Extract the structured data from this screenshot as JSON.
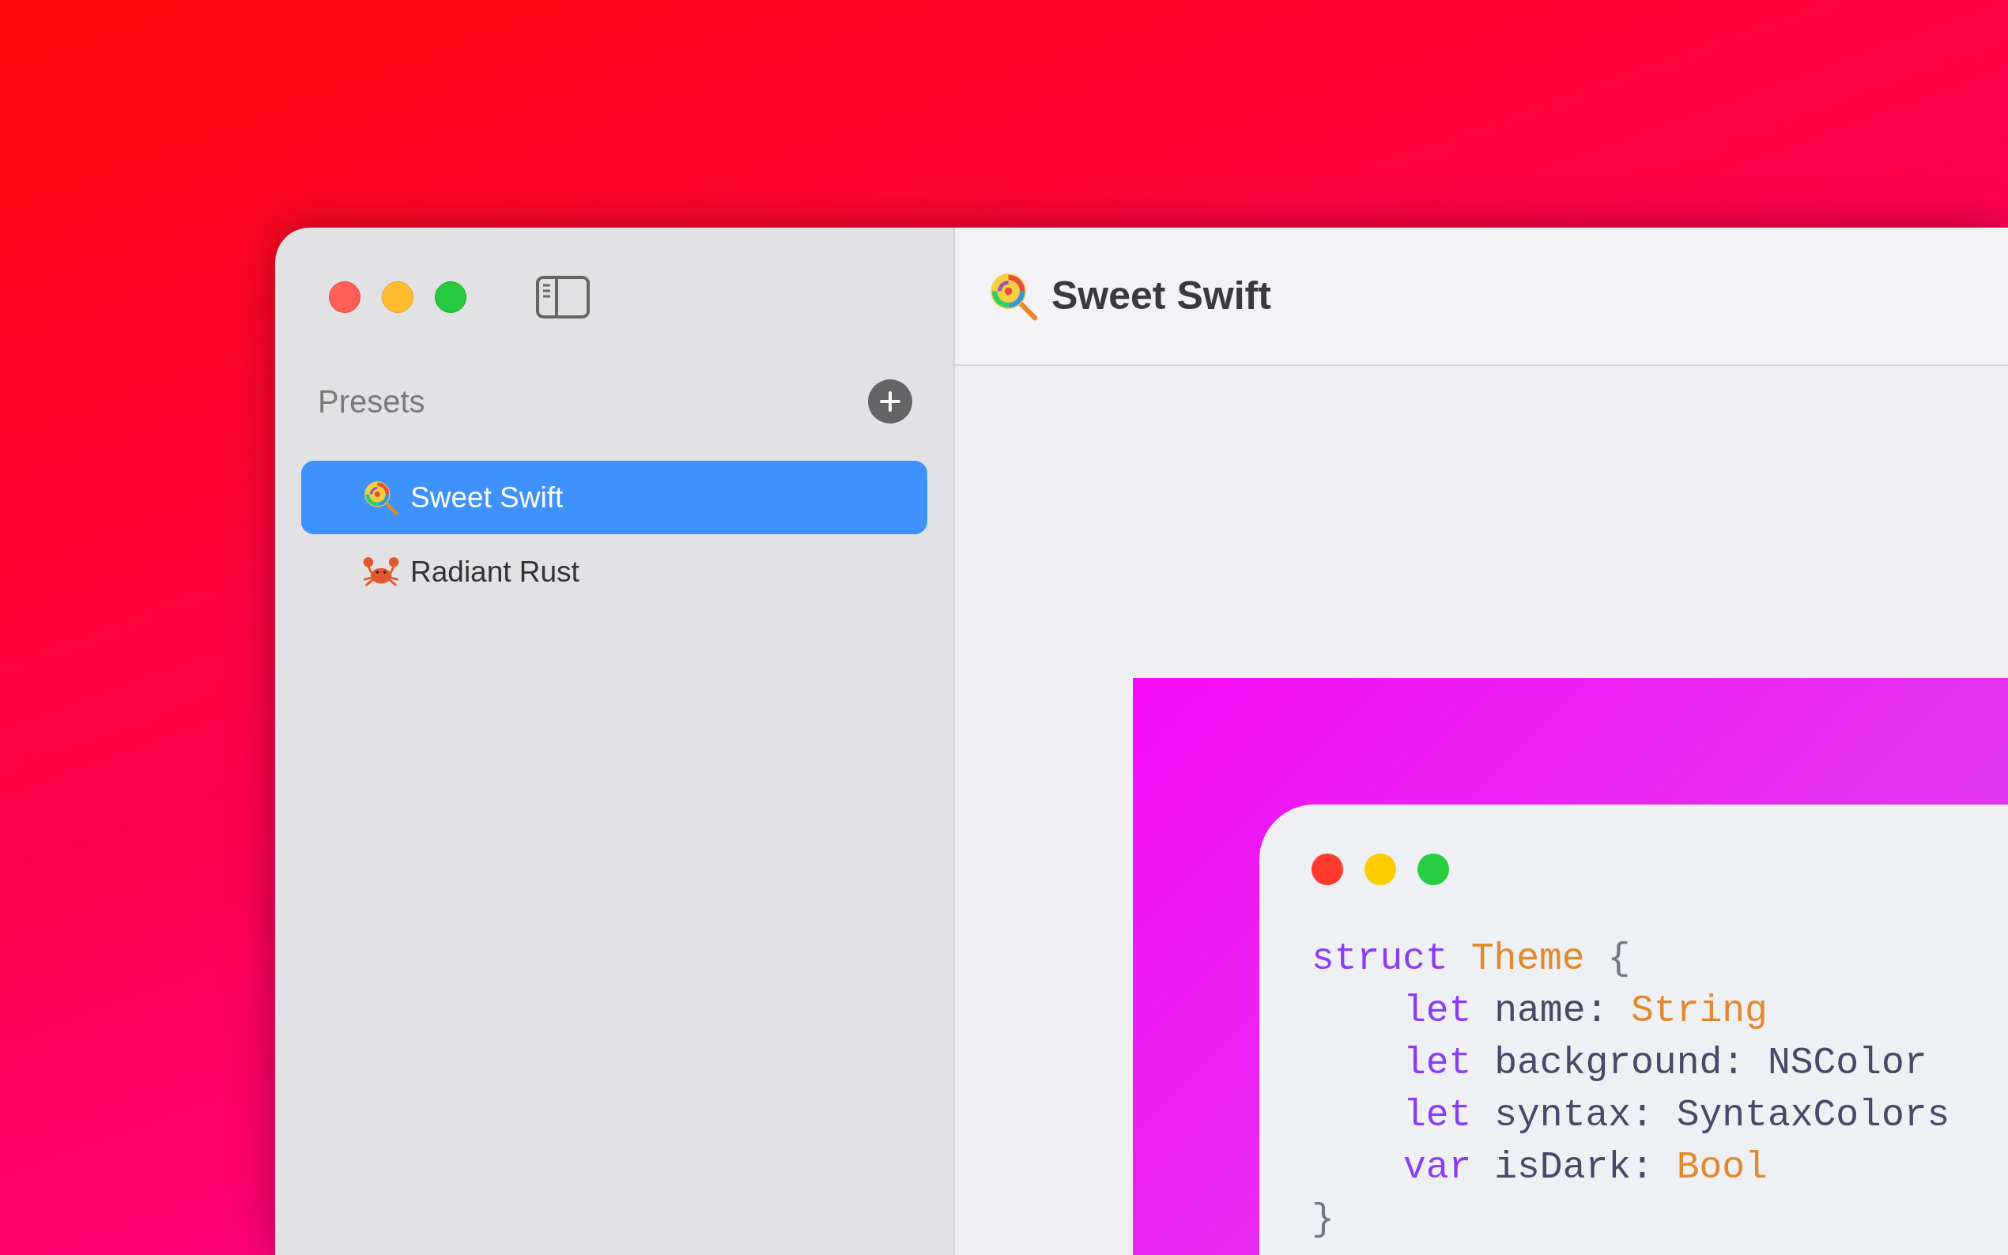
{
  "window": {
    "title": "Sweet Swift"
  },
  "sidebar": {
    "heading": "Presets",
    "items": [
      {
        "label": "Sweet Swift",
        "selected": true
      },
      {
        "label": "Radiant Rust",
        "selected": false
      }
    ]
  },
  "preview": {
    "code_lines": [
      {
        "tokens": [
          {
            "kind": "keyword",
            "text": "struct"
          },
          {
            "kind": "type",
            "text": "Theme"
          },
          {
            "kind": "punct",
            "text": "{"
          }
        ],
        "children": [
          {
            "tokens": [
              {
                "kind": "keyword",
                "text": "let"
              },
              {
                "kind": "plain",
                "text": "name:"
              },
              {
                "kind": "type",
                "text": "String"
              }
            ]
          },
          {
            "tokens": [
              {
                "kind": "keyword",
                "text": "let"
              },
              {
                "kind": "plain",
                "text": "background:"
              },
              {
                "kind": "plain",
                "text": "NSColor"
              }
            ]
          },
          {
            "tokens": [
              {
                "kind": "keyword",
                "text": "let"
              },
              {
                "kind": "plain",
                "text": "syntax:"
              },
              {
                "kind": "plain",
                "text": "SyntaxColors"
              }
            ]
          },
          {
            "tokens": [
              {
                "kind": "keyword",
                "text": "var"
              },
              {
                "kind": "plain",
                "text": "isDark:"
              },
              {
                "kind": "type",
                "text": "Bool"
              }
            ]
          }
        ]
      },
      {
        "tokens": [
          {
            "kind": "punct",
            "text": "}"
          }
        ]
      }
    ]
  }
}
